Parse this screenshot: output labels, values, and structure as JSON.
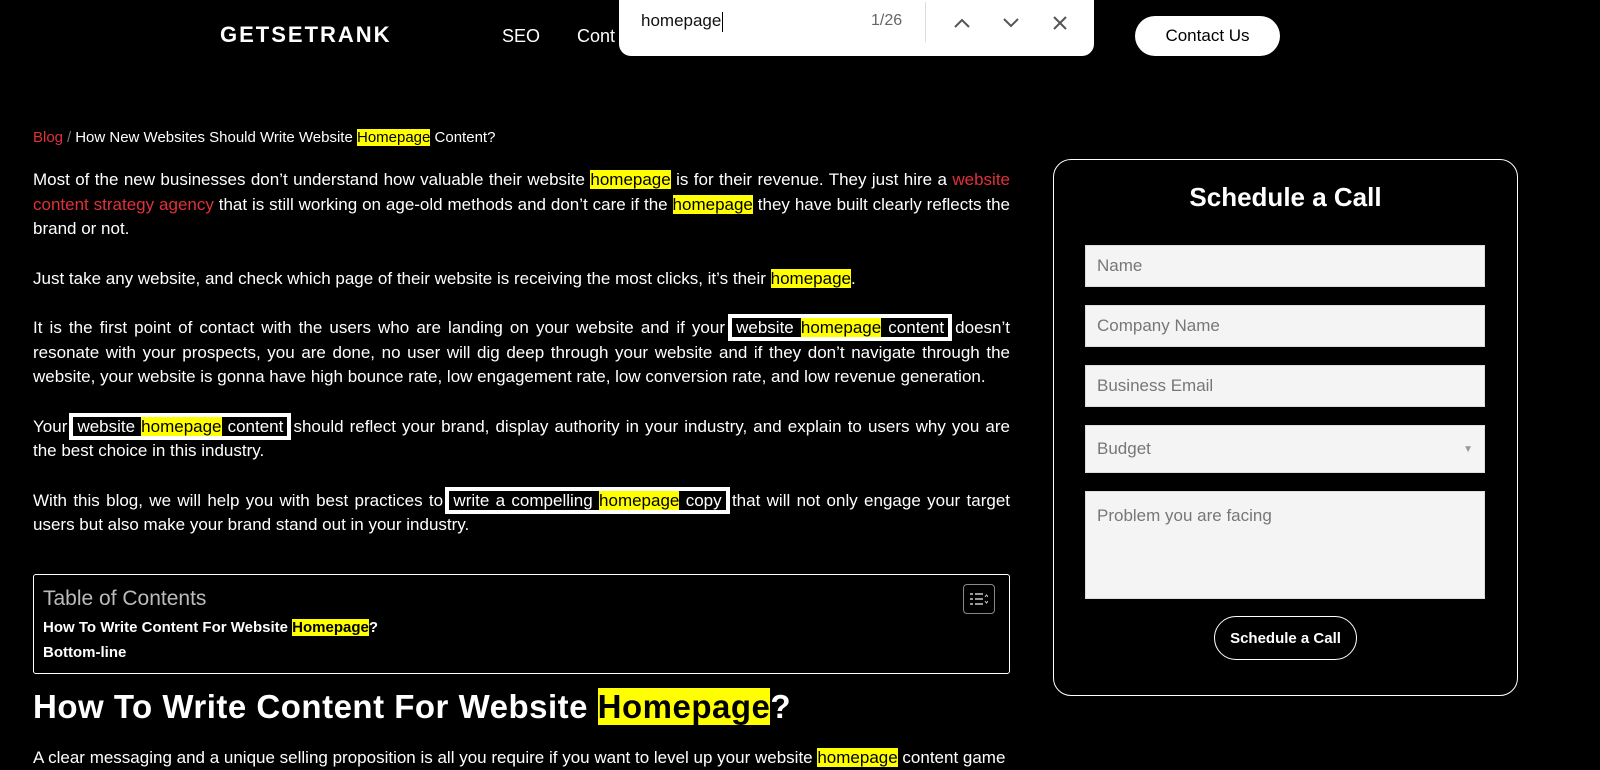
{
  "header": {
    "logo": "GETSETRANK",
    "nav_seo": "SEO",
    "nav_cont": "Cont",
    "contact_button": "Contact Us"
  },
  "find_bar": {
    "query": "homepage",
    "count": "1/26",
    "up_icon": "chevron-up-icon",
    "down_icon": "chevron-down-icon",
    "close_icon": "close-icon"
  },
  "breadcrumb": {
    "blog": "Blog",
    "separator": "/",
    "current_pre": "How New Websites Should Write Website ",
    "current_hl": "Homepage",
    "current_post": " Content?"
  },
  "article": {
    "p1": {
      "a": "Most of the new businesses don’t understand how valuable their website ",
      "hl1": "homepage",
      "b": " is for their revenue. They just hire a ",
      "link": "website content strategy agency",
      "c": " that is still working on age-old methods and don’t care if the ",
      "hl2": "homepage",
      "d": " they have built clearly reflects the brand or not."
    },
    "p2": {
      "a": "Just take any website, and check which page of their website is receiving the most clicks, it’s their ",
      "hl": "homepage",
      "b": "."
    },
    "p3": {
      "a": "It is the first point of contact with the users who are landing on your website and if your ",
      "box_pre": "website ",
      "hl": "homepage",
      "box_post": " content",
      "b": " doesn’t resonate with your prospects, you are done, no user will dig deep through your website and if they don’t navigate through the website, your website is gonna have high bounce rate, low engagement rate, low conversion rate, and low revenue generation."
    },
    "p4": {
      "a": "Your ",
      "box_pre": "website ",
      "hl": "homepage",
      "box_post": " content",
      "b": " should reflect your brand, display authority in your industry, and explain to users why you are the best choice in this industry."
    },
    "p5": {
      "a": "With this blog, we will help you with best practices to ",
      "box_pre": "write a compelling ",
      "hl": "homepage",
      "box_post": " copy",
      "b": " that will not only engage your target users but also make your brand stand out in your industry."
    }
  },
  "toc": {
    "title": "Table of Contents",
    "toggle_icon": "list-toggle-icon",
    "item1_pre": "How To Write Content For Website ",
    "item1_hl": "Homepage",
    "item1_post": "?",
    "item2": "Bottom-line"
  },
  "heading": {
    "pre": "How To Write Content For Website ",
    "hl": "Homepage",
    "post": "?"
  },
  "last_paragraph": {
    "a": "A clear messaging and a unique selling proposition is all you require if you want to level up your website ",
    "hl": "homepage",
    "b": " content game"
  },
  "form": {
    "title": "Schedule a Call",
    "name_placeholder": "Name",
    "company_placeholder": "Company Name",
    "email_placeholder": "Business Email",
    "budget_selected": "Budget",
    "problem_placeholder": "Problem you are facing",
    "submit": "Schedule a Call"
  },
  "colors": {
    "highlight": "#ffff00",
    "link_red": "#e0303a",
    "background": "#000000"
  }
}
